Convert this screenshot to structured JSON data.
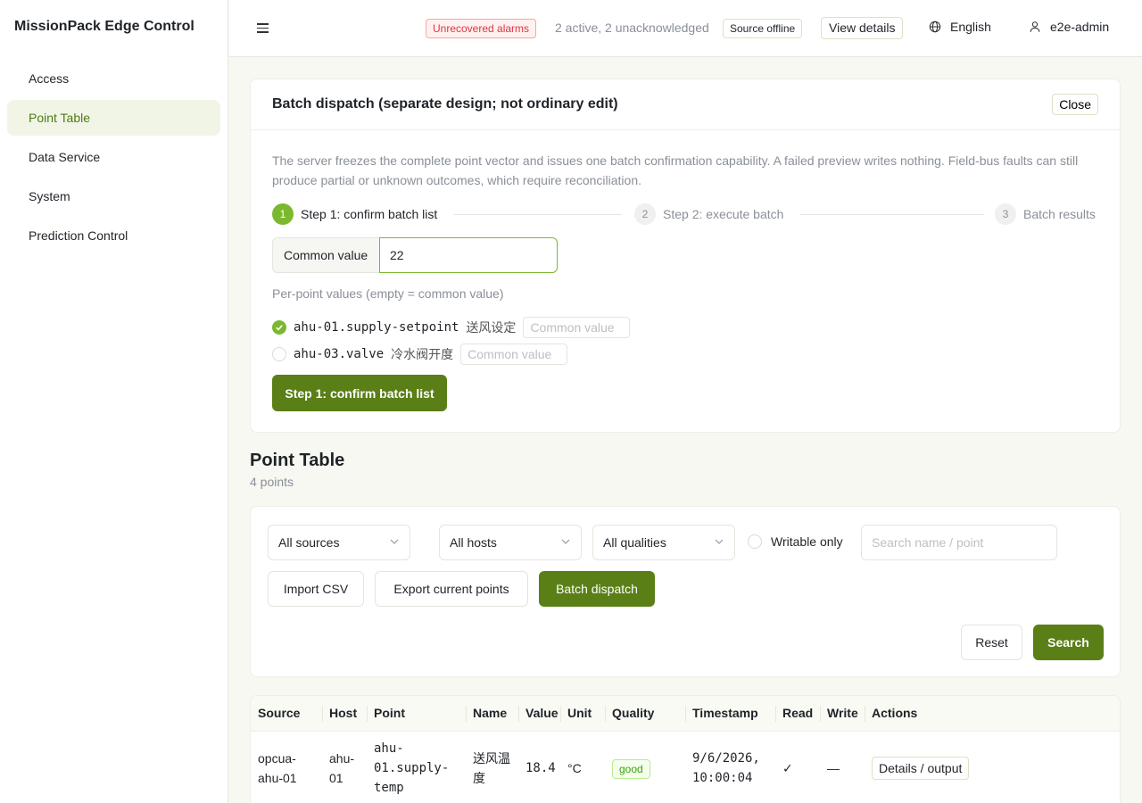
{
  "app": {
    "title": "MissionPack Edge Control"
  },
  "sidebar": {
    "items": [
      {
        "label": "Access"
      },
      {
        "label": "Point Table"
      },
      {
        "label": "Data Service"
      },
      {
        "label": "System"
      },
      {
        "label": "Prediction Control"
      }
    ]
  },
  "header": {
    "alarm_badge": "Unrecovered alarms",
    "alarm_text": "2 active, 2 unacknowledged",
    "source_tag": "Source offline",
    "view_details": "View details",
    "language": "English",
    "user": "e2e-admin"
  },
  "batch": {
    "title": "Batch dispatch (separate design; not ordinary edit)",
    "close_label": "Close",
    "description": "The server freezes the complete point vector and issues one batch confirmation capability. A failed preview writes nothing. Field-bus faults can still produce partial or unknown outcomes, which require reconciliation.",
    "steps": [
      {
        "num": "1",
        "label": "Step 1: confirm batch list"
      },
      {
        "num": "2",
        "label": "Step 2: execute batch"
      },
      {
        "num": "3",
        "label": "Batch results"
      }
    ],
    "common_label": "Common value",
    "common_value": "22",
    "per_point_label": "Per-point values (empty = common value)",
    "points": [
      {
        "id": "ahu-01.supply-setpoint",
        "name": "送风设定",
        "placeholder": "Common value",
        "checked": true
      },
      {
        "id": "ahu-03.valve",
        "name": "冷水阀开度",
        "placeholder": "Common value",
        "checked": false
      }
    ],
    "confirm_label": "Step 1: confirm batch list"
  },
  "point_table": {
    "title": "Point Table",
    "count": "4 points"
  },
  "filters": {
    "source": "All sources",
    "host": "All hosts",
    "quality": "All qualities",
    "writable_label": "Writable only",
    "search_placeholder": "Search name / point",
    "import_label": "Import CSV",
    "export_label": "Export current points",
    "batch_label": "Batch dispatch",
    "reset_label": "Reset",
    "search_label": "Search"
  },
  "table": {
    "columns": [
      "Source",
      "Host",
      "Point",
      "Name",
      "Value",
      "Unit",
      "Quality",
      "Timestamp",
      "Read",
      "Write",
      "Actions"
    ],
    "rows": [
      {
        "source": "opcua-ahu-01",
        "host": "ahu-01",
        "point": "ahu-01.supply-temp",
        "name": "送风温度",
        "value": "18.4",
        "unit": "°C",
        "quality": "good",
        "timestamp": "9/6/2026, 10:00:04",
        "read": "✓",
        "write": "—",
        "action": "Details / output"
      }
    ]
  },
  "colors": {
    "accent": "#5a7f17",
    "accent_light": "#7cb82f",
    "alarm": "#d9363e"
  }
}
